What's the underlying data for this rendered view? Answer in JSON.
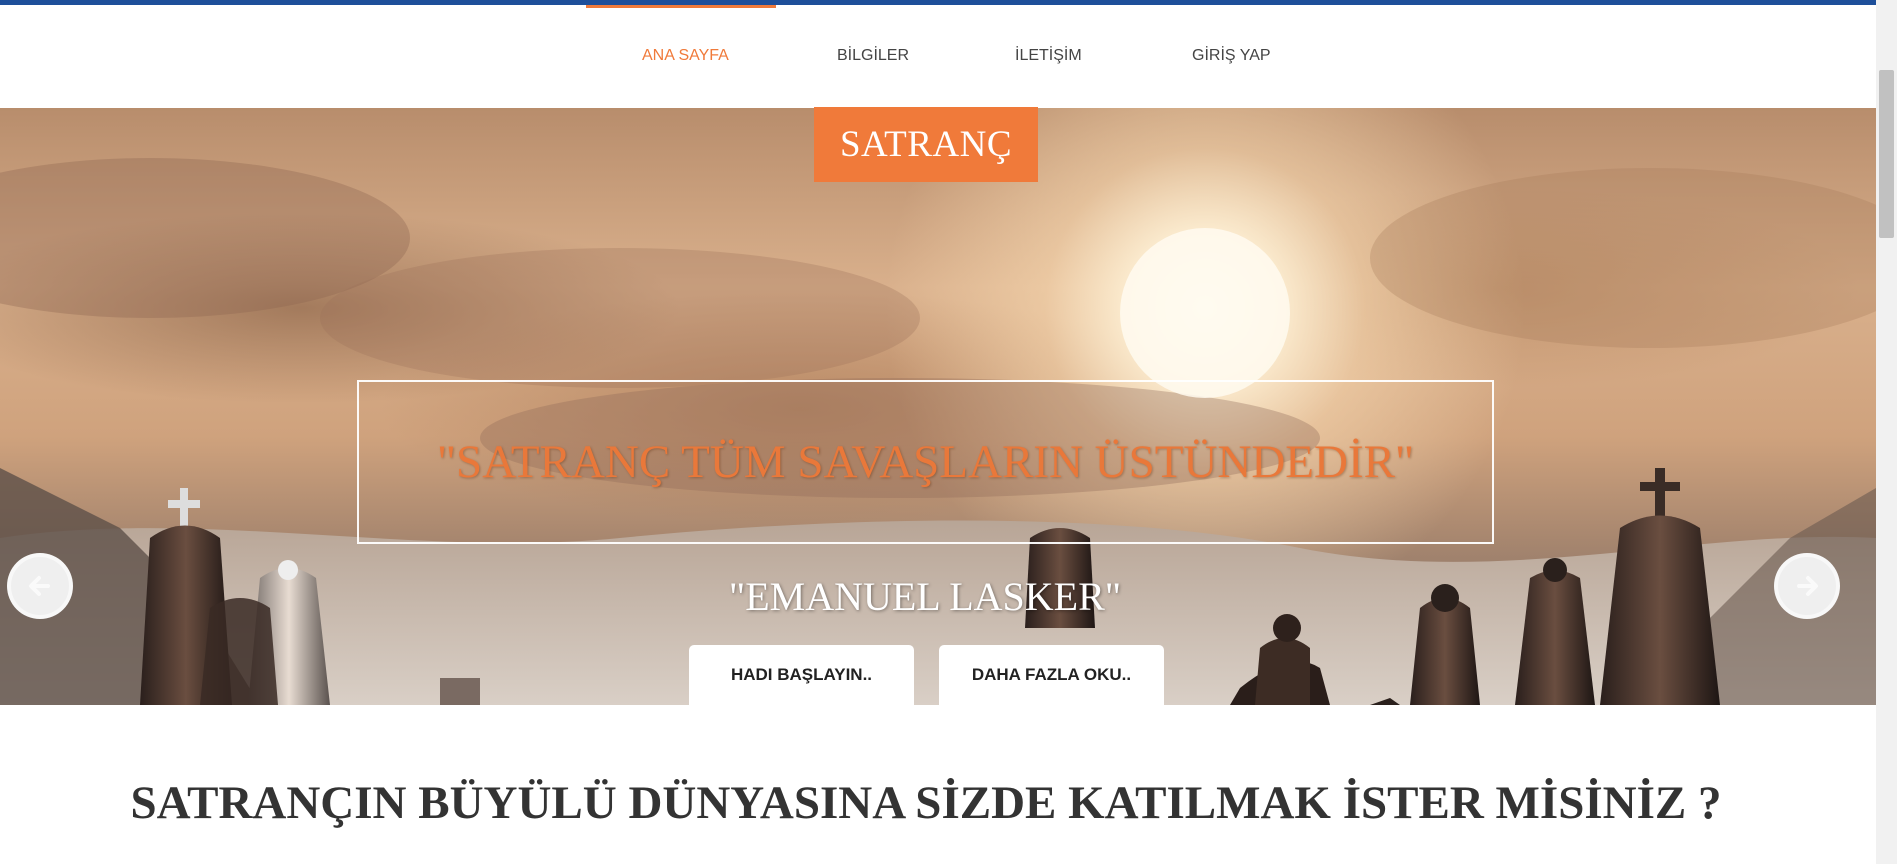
{
  "nav": {
    "items": [
      {
        "label": "ANA SAYFA",
        "active": true
      },
      {
        "label": "BİLGİLER",
        "active": false
      },
      {
        "label": "İLETİŞİM",
        "active": false
      },
      {
        "label": "GİRİŞ YAP",
        "active": false
      }
    ]
  },
  "hero": {
    "brand": "SATRANÇ",
    "quote": "\"SATRANÇ TÜM SAVAŞLARIN ÜSTÜNDEDİR\"",
    "author": "\"EMANUEL LASKER\"",
    "buttons": {
      "start": "HADI BAŞLAYIN..",
      "read_more": "DAHA FAZLA OKU.."
    },
    "prev_icon": "arrow-left-circle-icon",
    "next_icon": "arrow-right-circle-icon"
  },
  "section": {
    "heading": "SATRANÇIN BÜYÜLÜ DÜNYASINA SİZDE KATILMAK İSTER MİSİNİZ ?"
  },
  "colors": {
    "accent": "#f07a3a",
    "top_stripe": "#1e4f9a"
  }
}
